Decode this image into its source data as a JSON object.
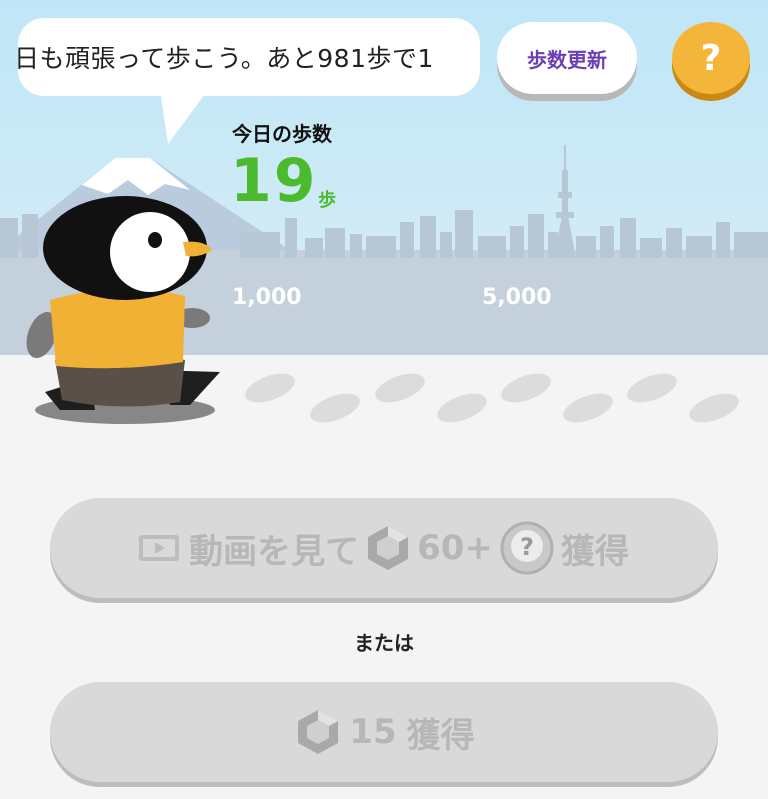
{
  "speech_bubble": {
    "text": "日も頑張って歩こう。あと981歩で1"
  },
  "header": {
    "update_steps_label": "歩数更新",
    "help_label": "?"
  },
  "today": {
    "label": "今日の歩数",
    "count": "19",
    "unit": "歩"
  },
  "milestones": [
    "1,000",
    "5,000"
  ],
  "video_reward_button": {
    "prefix": "動画を見て",
    "amount": "60+",
    "suffix": "獲得"
  },
  "or_label": "または",
  "gem_reward_button": {
    "amount": "15",
    "suffix": "獲得"
  },
  "colors": {
    "accent_green": "#4cba2f",
    "update_purple": "#6a3fb5",
    "help_yellow": "#f4b63a",
    "disabled_gray": "#d9d9d9"
  }
}
